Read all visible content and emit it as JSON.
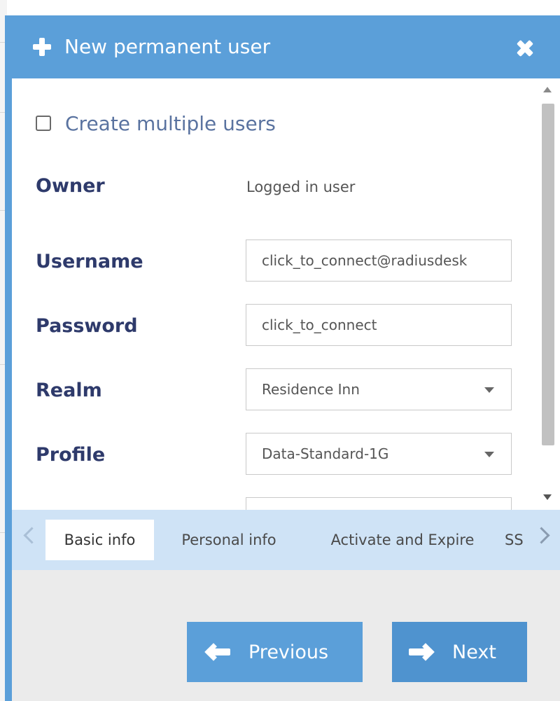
{
  "window": {
    "title": "New permanent user"
  },
  "form": {
    "multiple_users_label": "Create multiple users",
    "owner_label": "Owner",
    "owner_value": "Logged in user",
    "username_label": "Username",
    "username_value": "click_to_connect@radiusdesk",
    "password_label": "Password",
    "password_value": "click_to_connect",
    "realm_label": "Realm",
    "realm_value": "Residence Inn",
    "profile_label": "Profile",
    "profile_value": "Data-Standard-1G"
  },
  "tabs": [
    {
      "label": "Basic info",
      "active": true
    },
    {
      "label": "Personal info",
      "active": false
    },
    {
      "label": "Activate and Expire",
      "active": false
    },
    {
      "label": "SSID",
      "active": false
    }
  ],
  "buttons": {
    "previous_label": "Previous",
    "next_label": "Next"
  },
  "colors": {
    "accent": "#5b9fd9",
    "label": "#2e3a6b",
    "tab_strip": "#cfe3f6"
  },
  "icons": {
    "title": "plus-icon",
    "close": "close-icon",
    "previous": "arrow-left-icon",
    "next": "arrow-right-icon"
  }
}
